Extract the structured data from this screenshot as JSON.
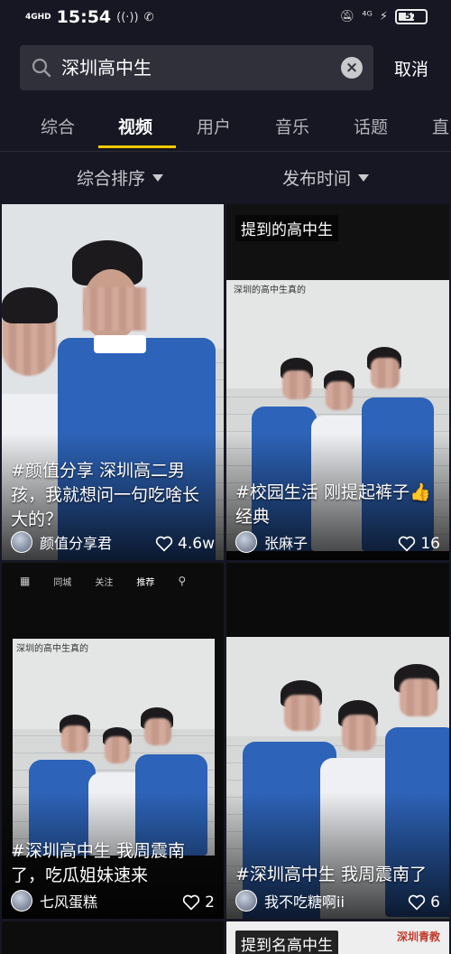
{
  "status": {
    "network": "4GHD",
    "time": "15:54",
    "battery": "57"
  },
  "search": {
    "query": "深圳高中生",
    "cancel_label": "取消"
  },
  "tabs": [
    "综合",
    "视频",
    "用户",
    "音乐",
    "话题",
    "直"
  ],
  "active_tab": 1,
  "filters": {
    "sort": "综合排序",
    "time": "发布时间"
  },
  "cards": [
    {
      "caption": "#颜值分享  深圳高二男孩，我就想问一句吃啥长大的？",
      "author": "颜值分享君",
      "likes": "4.6w"
    },
    {
      "chip": "提到的高中生",
      "inner_label": "深圳的高中生真的",
      "caption": "#校园生活    刚提起裤子👍 经典",
      "author": "张麻子",
      "likes": "16"
    },
    {
      "inner_tabs": [
        "同城",
        "关注",
        "推荐"
      ],
      "inner_label": "深圳的高中生真的",
      "caption": "#深圳高中生 我周震南了，吃瓜姐妹速来",
      "author": "七风蛋糕",
      "likes": "2"
    },
    {
      "caption": "#深圳高中生 我周震南了",
      "author": "我不吃糖啊ii",
      "likes": "6"
    },
    {
      "chip": "提到名高中生",
      "watermark": "深圳青教"
    }
  ],
  "colors": {
    "background": "#161723",
    "tab_indicator": "#f6c900",
    "shirt_blue": "#2d63b8"
  }
}
